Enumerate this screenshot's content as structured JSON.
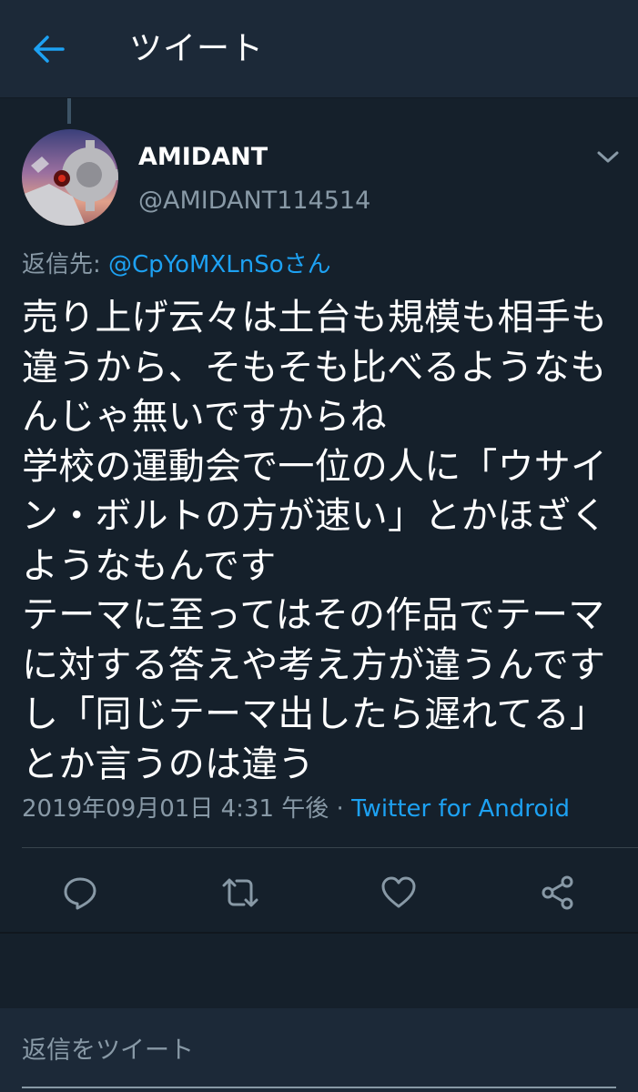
{
  "header": {
    "title": "ツイート",
    "back_icon": "arrow-left-icon"
  },
  "tweet": {
    "author": {
      "display_name": "AMIDANT",
      "handle": "@AMIDANT114514"
    },
    "reply_to": {
      "prefix": "返信先: ",
      "user": "@CpYoMXLnSoさん"
    },
    "body_lines": [
      "売り上げ云々は土台も規模も相手も",
      "違うから、そもそも比べるようなも",
      "んじゃ無いですからね",
      "学校の運動会で一位の人に「ウサイ",
      "ン・ボルトの方が速い」とかほざく",
      "ようなもんです",
      "テーマに至ってはその作品でテーマ",
      "に対する答えや考え方が違うんです",
      "し「同じテーマ出したら遅れてる」",
      "とか言うのは違う"
    ],
    "timestamp": "2019年09月01日 4:31 午後",
    "separator": " · ",
    "source": "Twitter for Android"
  },
  "actions": [
    {
      "name": "reply",
      "icon": "reply-icon"
    },
    {
      "name": "retweet",
      "icon": "retweet-icon"
    },
    {
      "name": "like",
      "icon": "heart-icon"
    },
    {
      "name": "share",
      "icon": "share-icon"
    }
  ],
  "reply_box": {
    "placeholder": "返信をツイート"
  },
  "colors": {
    "background": "#15202b",
    "header_background": "#1c2938",
    "accent": "#1da1f2",
    "secondary_text": "#8899a6",
    "divider": "#38444d"
  }
}
